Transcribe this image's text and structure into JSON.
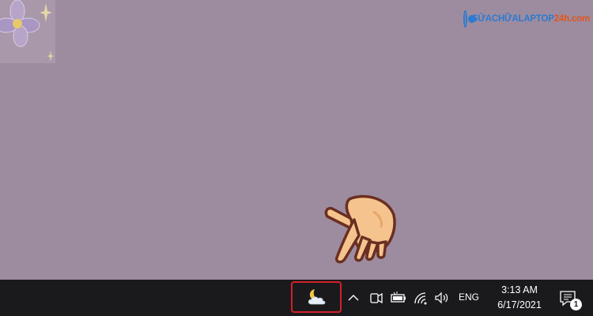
{
  "watermark": {
    "brand_main": "SỬACHỮALAPTOP",
    "brand_accent": "24h.com"
  },
  "taskbar": {
    "weather_icon": "cloudy-night-icon",
    "tray": {
      "show_hidden_icon": "chevron-up-icon",
      "meet_now_icon": "camera-icon",
      "battery_icon": "battery-icon",
      "network_icon": "wifi-icon",
      "volume_icon": "speaker-icon"
    },
    "language": "ENG",
    "time": "3:13 AM",
    "date": "6/17/2021",
    "notification_count": "1"
  },
  "colors": {
    "desktop": "#9d8ca0",
    "taskbar": "#1a1a1d",
    "highlight": "#d4202b",
    "brand_blue": "#2c7bd0",
    "brand_orange": "#e2551b"
  }
}
